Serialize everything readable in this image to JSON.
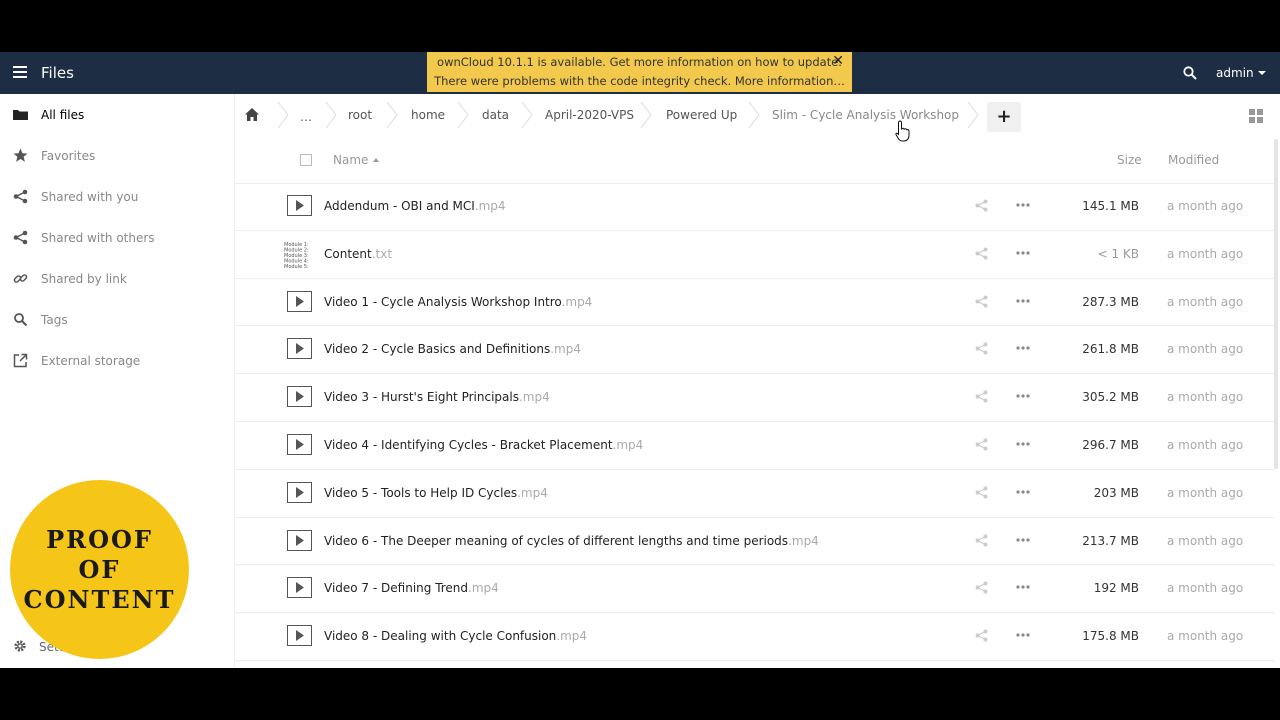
{
  "app": {
    "title": "Files",
    "user": "admin"
  },
  "notification": {
    "line1": "ownCloud 10.1.1 is available. Get more information on how to update.",
    "line2": "There were problems with the code integrity check. More information…",
    "close": "✕"
  },
  "sidebar": {
    "items": [
      {
        "label": "All files",
        "icon": "folder-icon"
      },
      {
        "label": "Favorites",
        "icon": "star-icon"
      },
      {
        "label": "Shared with you",
        "icon": "share-icon"
      },
      {
        "label": "Shared with others",
        "icon": "share-icon"
      },
      {
        "label": "Shared by link",
        "icon": "link-icon"
      },
      {
        "label": "Tags",
        "icon": "tag-icon"
      },
      {
        "label": "External storage",
        "icon": "external-icon"
      }
    ],
    "settings_label": "Setti"
  },
  "breadcrumb": {
    "items": [
      "…",
      "root",
      "home",
      "data",
      "April-2020-VPS",
      "Powered Up",
      "Slim - Cycle Analysis Workshop"
    ],
    "add_label": "+"
  },
  "list": {
    "header": {
      "name": "Name",
      "size": "Size",
      "modified": "Modified"
    },
    "rows": [
      {
        "name": "Addendum - OBI and MCI",
        "ext": ".mp4",
        "size": "145.1 MB",
        "modified": "a month ago",
        "type": "video"
      },
      {
        "name": "Content",
        "ext": ".txt",
        "size": "< 1 KB",
        "modified": "a month ago",
        "type": "text"
      },
      {
        "name": "Video 1 - Cycle Analysis Workshop Intro",
        "ext": ".mp4",
        "size": "287.3 MB",
        "modified": "a month ago",
        "type": "video"
      },
      {
        "name": "Video 2 - Cycle Basics and Definitions",
        "ext": ".mp4",
        "size": "261.8 MB",
        "modified": "a month ago",
        "type": "video"
      },
      {
        "name": "Video 3 - Hurst's Eight Principals",
        "ext": ".mp4",
        "size": "305.2 MB",
        "modified": "a month ago",
        "type": "video"
      },
      {
        "name": "Video 4 - Identifying Cycles - Bracket Placement",
        "ext": ".mp4",
        "size": "296.7 MB",
        "modified": "a month ago",
        "type": "video"
      },
      {
        "name": "Video 5 - Tools to Help ID Cycles",
        "ext": ".mp4",
        "size": "203 MB",
        "modified": "a month ago",
        "type": "video"
      },
      {
        "name": "Video 6 - The Deeper meaning of cycles of different lengths and time periods",
        "ext": ".mp4",
        "size": "213.7 MB",
        "modified": "a month ago",
        "type": "video"
      },
      {
        "name": "Video 7 - Defining Trend",
        "ext": ".mp4",
        "size": "192 MB",
        "modified": "a month ago",
        "type": "video"
      },
      {
        "name": "Video 8 - Dealing with Cycle Confusion",
        "ext": ".mp4",
        "size": "175.8 MB",
        "modified": "a month ago",
        "type": "video"
      }
    ]
  },
  "stamp": {
    "lines": [
      "PROOF",
      "OF",
      "CONTENT"
    ],
    "color": "#f5c518"
  },
  "colors": {
    "topbar": "#1d2d44",
    "notification": "#f2c94c"
  }
}
